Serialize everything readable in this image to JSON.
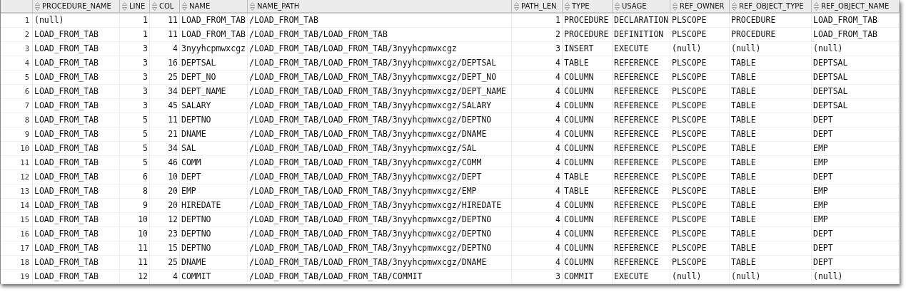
{
  "table": {
    "columns": [
      {
        "label": "PROCEDURE_NAME",
        "kind": "text"
      },
      {
        "label": "LINE",
        "kind": "number"
      },
      {
        "label": "COL",
        "kind": "number"
      },
      {
        "label": "NAME",
        "kind": "text"
      },
      {
        "label": "NAME_PATH",
        "kind": "text"
      },
      {
        "label": "PATH_LEN",
        "kind": "number"
      },
      {
        "label": "TYPE",
        "kind": "text"
      },
      {
        "label": "USAGE",
        "kind": "text"
      },
      {
        "label": "REF_OWNER",
        "kind": "text"
      },
      {
        "label": "REF_OBJECT_TYPE",
        "kind": "text"
      },
      {
        "label": "REF_OBJECT_NAME",
        "kind": "text"
      }
    ],
    "rows": [
      {
        "row_number": "1",
        "cells": [
          "(null)",
          "1",
          "11",
          "LOAD_FROM_TAB",
          "/LOAD_FROM_TAB",
          "1",
          "PROCEDURE",
          "DECLARATION",
          "PLSCOPE",
          "PROCEDURE",
          "LOAD_FROM_TAB"
        ]
      },
      {
        "row_number": "2",
        "cells": [
          "LOAD_FROM_TAB",
          "1",
          "11",
          "LOAD_FROM_TAB",
          "/LOAD_FROM_TAB/LOAD_FROM_TAB",
          "2",
          "PROCEDURE",
          "DEFINITION",
          "PLSCOPE",
          "PROCEDURE",
          "LOAD_FROM_TAB"
        ]
      },
      {
        "row_number": "3",
        "cells": [
          "LOAD_FROM_TAB",
          "3",
          "4",
          "3nyyhcpmwxcgz",
          "/LOAD_FROM_TAB/LOAD_FROM_TAB/3nyyhcpmwxcgz",
          "3",
          "INSERT",
          "EXECUTE",
          "(null)",
          "(null)",
          "(null)"
        ]
      },
      {
        "row_number": "4",
        "cells": [
          "LOAD_FROM_TAB",
          "3",
          "16",
          "DEPTSAL",
          "/LOAD_FROM_TAB/LOAD_FROM_TAB/3nyyhcpmwxcgz/DEPTSAL",
          "4",
          "TABLE",
          "REFERENCE",
          "PLSCOPE",
          "TABLE",
          "DEPTSAL"
        ]
      },
      {
        "row_number": "5",
        "cells": [
          "LOAD_FROM_TAB",
          "3",
          "25",
          "DEPT_NO",
          "/LOAD_FROM_TAB/LOAD_FROM_TAB/3nyyhcpmwxcgz/DEPT_NO",
          "4",
          "COLUMN",
          "REFERENCE",
          "PLSCOPE",
          "TABLE",
          "DEPTSAL"
        ]
      },
      {
        "row_number": "6",
        "cells": [
          "LOAD_FROM_TAB",
          "3",
          "34",
          "DEPT_NAME",
          "/LOAD_FROM_TAB/LOAD_FROM_TAB/3nyyhcpmwxcgz/DEPT_NAME",
          "4",
          "COLUMN",
          "REFERENCE",
          "PLSCOPE",
          "TABLE",
          "DEPTSAL"
        ]
      },
      {
        "row_number": "7",
        "cells": [
          "LOAD_FROM_TAB",
          "3",
          "45",
          "SALARY",
          "/LOAD_FROM_TAB/LOAD_FROM_TAB/3nyyhcpmwxcgz/SALARY",
          "4",
          "COLUMN",
          "REFERENCE",
          "PLSCOPE",
          "TABLE",
          "DEPTSAL"
        ]
      },
      {
        "row_number": "8",
        "cells": [
          "LOAD_FROM_TAB",
          "5",
          "11",
          "DEPTNO",
          "/LOAD_FROM_TAB/LOAD_FROM_TAB/3nyyhcpmwxcgz/DEPTNO",
          "4",
          "COLUMN",
          "REFERENCE",
          "PLSCOPE",
          "TABLE",
          "DEPT"
        ]
      },
      {
        "row_number": "9",
        "cells": [
          "LOAD_FROM_TAB",
          "5",
          "21",
          "DNAME",
          "/LOAD_FROM_TAB/LOAD_FROM_TAB/3nyyhcpmwxcgz/DNAME",
          "4",
          "COLUMN",
          "REFERENCE",
          "PLSCOPE",
          "TABLE",
          "DEPT"
        ]
      },
      {
        "row_number": "10",
        "cells": [
          "LOAD_FROM_TAB",
          "5",
          "34",
          "SAL",
          "/LOAD_FROM_TAB/LOAD_FROM_TAB/3nyyhcpmwxcgz/SAL",
          "4",
          "COLUMN",
          "REFERENCE",
          "PLSCOPE",
          "TABLE",
          "EMP"
        ]
      },
      {
        "row_number": "11",
        "cells": [
          "LOAD_FROM_TAB",
          "5",
          "46",
          "COMM",
          "/LOAD_FROM_TAB/LOAD_FROM_TAB/3nyyhcpmwxcgz/COMM",
          "4",
          "COLUMN",
          "REFERENCE",
          "PLSCOPE",
          "TABLE",
          "EMP"
        ]
      },
      {
        "row_number": "12",
        "cells": [
          "LOAD_FROM_TAB",
          "6",
          "10",
          "DEPT",
          "/LOAD_FROM_TAB/LOAD_FROM_TAB/3nyyhcpmwxcgz/DEPT",
          "4",
          "TABLE",
          "REFERENCE",
          "PLSCOPE",
          "TABLE",
          "DEPT"
        ]
      },
      {
        "row_number": "13",
        "cells": [
          "LOAD_FROM_TAB",
          "8",
          "20",
          "EMP",
          "/LOAD_FROM_TAB/LOAD_FROM_TAB/3nyyhcpmwxcgz/EMP",
          "4",
          "TABLE",
          "REFERENCE",
          "PLSCOPE",
          "TABLE",
          "EMP"
        ]
      },
      {
        "row_number": "14",
        "cells": [
          "LOAD_FROM_TAB",
          "9",
          "20",
          "HIREDATE",
          "/LOAD_FROM_TAB/LOAD_FROM_TAB/3nyyhcpmwxcgz/HIREDATE",
          "4",
          "COLUMN",
          "REFERENCE",
          "PLSCOPE",
          "TABLE",
          "EMP"
        ]
      },
      {
        "row_number": "15",
        "cells": [
          "LOAD_FROM_TAB",
          "10",
          "12",
          "DEPTNO",
          "/LOAD_FROM_TAB/LOAD_FROM_TAB/3nyyhcpmwxcgz/DEPTNO",
          "4",
          "COLUMN",
          "REFERENCE",
          "PLSCOPE",
          "TABLE",
          "EMP"
        ]
      },
      {
        "row_number": "16",
        "cells": [
          "LOAD_FROM_TAB",
          "10",
          "23",
          "DEPTNO",
          "/LOAD_FROM_TAB/LOAD_FROM_TAB/3nyyhcpmwxcgz/DEPTNO",
          "4",
          "COLUMN",
          "REFERENCE",
          "PLSCOPE",
          "TABLE",
          "DEPT"
        ]
      },
      {
        "row_number": "17",
        "cells": [
          "LOAD_FROM_TAB",
          "11",
          "15",
          "DEPTNO",
          "/LOAD_FROM_TAB/LOAD_FROM_TAB/3nyyhcpmwxcgz/DEPTNO",
          "4",
          "COLUMN",
          "REFERENCE",
          "PLSCOPE",
          "TABLE",
          "DEPT"
        ]
      },
      {
        "row_number": "18",
        "cells": [
          "LOAD_FROM_TAB",
          "11",
          "25",
          "DNAME",
          "/LOAD_FROM_TAB/LOAD_FROM_TAB/3nyyhcpmwxcgz/DNAME",
          "4",
          "COLUMN",
          "REFERENCE",
          "PLSCOPE",
          "TABLE",
          "DEPT"
        ]
      },
      {
        "row_number": "19",
        "cells": [
          "LOAD_FROM_TAB",
          "12",
          "4",
          "COMMIT",
          "/LOAD_FROM_TAB/LOAD_FROM_TAB/COMMIT",
          "3",
          "COMMIT",
          "EXECUTE",
          "(null)",
          "(null)",
          "(null)"
        ]
      }
    ]
  }
}
